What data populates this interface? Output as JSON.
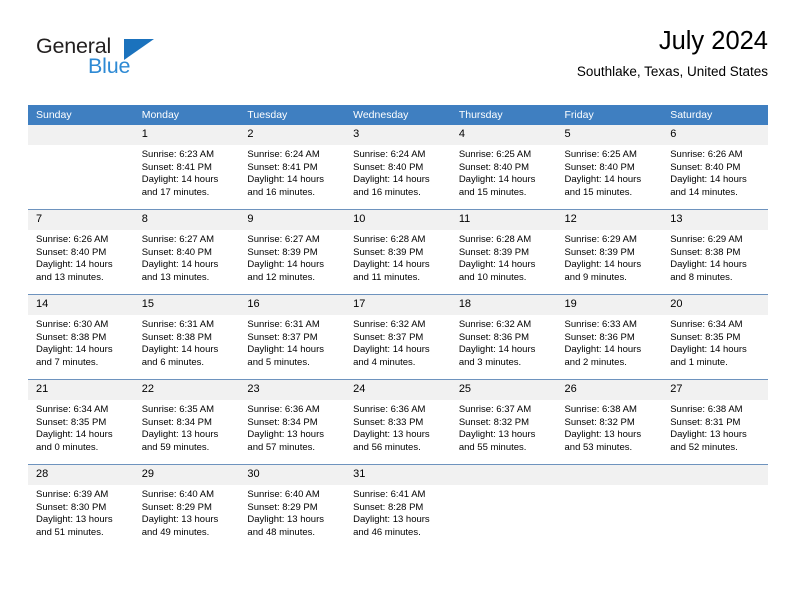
{
  "brand": {
    "name_dark": "General",
    "name_light": "Blue",
    "triangle_color": "#1b72bd",
    "light_color": "#2e8ad4"
  },
  "header": {
    "title": "July 2024",
    "subtitle": "Southlake, Texas, United States"
  },
  "theme": {
    "header_row_bg": "#3f7fc1",
    "day_number_bg": "#f1f1f1",
    "row_divider": "#6e93be"
  },
  "weekdays": [
    "Sunday",
    "Monday",
    "Tuesday",
    "Wednesday",
    "Thursday",
    "Friday",
    "Saturday"
  ],
  "weeks": [
    [
      {
        "day": "",
        "sunrise": "",
        "sunset": "",
        "daylight1": "",
        "daylight2": ""
      },
      {
        "day": "1",
        "sunrise": "Sunrise: 6:23 AM",
        "sunset": "Sunset: 8:41 PM",
        "daylight1": "Daylight: 14 hours",
        "daylight2": "and 17 minutes."
      },
      {
        "day": "2",
        "sunrise": "Sunrise: 6:24 AM",
        "sunset": "Sunset: 8:41 PM",
        "daylight1": "Daylight: 14 hours",
        "daylight2": "and 16 minutes."
      },
      {
        "day": "3",
        "sunrise": "Sunrise: 6:24 AM",
        "sunset": "Sunset: 8:40 PM",
        "daylight1": "Daylight: 14 hours",
        "daylight2": "and 16 minutes."
      },
      {
        "day": "4",
        "sunrise": "Sunrise: 6:25 AM",
        "sunset": "Sunset: 8:40 PM",
        "daylight1": "Daylight: 14 hours",
        "daylight2": "and 15 minutes."
      },
      {
        "day": "5",
        "sunrise": "Sunrise: 6:25 AM",
        "sunset": "Sunset: 8:40 PM",
        "daylight1": "Daylight: 14 hours",
        "daylight2": "and 15 minutes."
      },
      {
        "day": "6",
        "sunrise": "Sunrise: 6:26 AM",
        "sunset": "Sunset: 8:40 PM",
        "daylight1": "Daylight: 14 hours",
        "daylight2": "and 14 minutes."
      }
    ],
    [
      {
        "day": "7",
        "sunrise": "Sunrise: 6:26 AM",
        "sunset": "Sunset: 8:40 PM",
        "daylight1": "Daylight: 14 hours",
        "daylight2": "and 13 minutes."
      },
      {
        "day": "8",
        "sunrise": "Sunrise: 6:27 AM",
        "sunset": "Sunset: 8:40 PM",
        "daylight1": "Daylight: 14 hours",
        "daylight2": "and 13 minutes."
      },
      {
        "day": "9",
        "sunrise": "Sunrise: 6:27 AM",
        "sunset": "Sunset: 8:39 PM",
        "daylight1": "Daylight: 14 hours",
        "daylight2": "and 12 minutes."
      },
      {
        "day": "10",
        "sunrise": "Sunrise: 6:28 AM",
        "sunset": "Sunset: 8:39 PM",
        "daylight1": "Daylight: 14 hours",
        "daylight2": "and 11 minutes."
      },
      {
        "day": "11",
        "sunrise": "Sunrise: 6:28 AM",
        "sunset": "Sunset: 8:39 PM",
        "daylight1": "Daylight: 14 hours",
        "daylight2": "and 10 minutes."
      },
      {
        "day": "12",
        "sunrise": "Sunrise: 6:29 AM",
        "sunset": "Sunset: 8:39 PM",
        "daylight1": "Daylight: 14 hours",
        "daylight2": "and 9 minutes."
      },
      {
        "day": "13",
        "sunrise": "Sunrise: 6:29 AM",
        "sunset": "Sunset: 8:38 PM",
        "daylight1": "Daylight: 14 hours",
        "daylight2": "and 8 minutes."
      }
    ],
    [
      {
        "day": "14",
        "sunrise": "Sunrise: 6:30 AM",
        "sunset": "Sunset: 8:38 PM",
        "daylight1": "Daylight: 14 hours",
        "daylight2": "and 7 minutes."
      },
      {
        "day": "15",
        "sunrise": "Sunrise: 6:31 AM",
        "sunset": "Sunset: 8:38 PM",
        "daylight1": "Daylight: 14 hours",
        "daylight2": "and 6 minutes."
      },
      {
        "day": "16",
        "sunrise": "Sunrise: 6:31 AM",
        "sunset": "Sunset: 8:37 PM",
        "daylight1": "Daylight: 14 hours",
        "daylight2": "and 5 minutes."
      },
      {
        "day": "17",
        "sunrise": "Sunrise: 6:32 AM",
        "sunset": "Sunset: 8:37 PM",
        "daylight1": "Daylight: 14 hours",
        "daylight2": "and 4 minutes."
      },
      {
        "day": "18",
        "sunrise": "Sunrise: 6:32 AM",
        "sunset": "Sunset: 8:36 PM",
        "daylight1": "Daylight: 14 hours",
        "daylight2": "and 3 minutes."
      },
      {
        "day": "19",
        "sunrise": "Sunrise: 6:33 AM",
        "sunset": "Sunset: 8:36 PM",
        "daylight1": "Daylight: 14 hours",
        "daylight2": "and 2 minutes."
      },
      {
        "day": "20",
        "sunrise": "Sunrise: 6:34 AM",
        "sunset": "Sunset: 8:35 PM",
        "daylight1": "Daylight: 14 hours",
        "daylight2": "and 1 minute."
      }
    ],
    [
      {
        "day": "21",
        "sunrise": "Sunrise: 6:34 AM",
        "sunset": "Sunset: 8:35 PM",
        "daylight1": "Daylight: 14 hours",
        "daylight2": "and 0 minutes."
      },
      {
        "day": "22",
        "sunrise": "Sunrise: 6:35 AM",
        "sunset": "Sunset: 8:34 PM",
        "daylight1": "Daylight: 13 hours",
        "daylight2": "and 59 minutes."
      },
      {
        "day": "23",
        "sunrise": "Sunrise: 6:36 AM",
        "sunset": "Sunset: 8:34 PM",
        "daylight1": "Daylight: 13 hours",
        "daylight2": "and 57 minutes."
      },
      {
        "day": "24",
        "sunrise": "Sunrise: 6:36 AM",
        "sunset": "Sunset: 8:33 PM",
        "daylight1": "Daylight: 13 hours",
        "daylight2": "and 56 minutes."
      },
      {
        "day": "25",
        "sunrise": "Sunrise: 6:37 AM",
        "sunset": "Sunset: 8:32 PM",
        "daylight1": "Daylight: 13 hours",
        "daylight2": "and 55 minutes."
      },
      {
        "day": "26",
        "sunrise": "Sunrise: 6:38 AM",
        "sunset": "Sunset: 8:32 PM",
        "daylight1": "Daylight: 13 hours",
        "daylight2": "and 53 minutes."
      },
      {
        "day": "27",
        "sunrise": "Sunrise: 6:38 AM",
        "sunset": "Sunset: 8:31 PM",
        "daylight1": "Daylight: 13 hours",
        "daylight2": "and 52 minutes."
      }
    ],
    [
      {
        "day": "28",
        "sunrise": "Sunrise: 6:39 AM",
        "sunset": "Sunset: 8:30 PM",
        "daylight1": "Daylight: 13 hours",
        "daylight2": "and 51 minutes."
      },
      {
        "day": "29",
        "sunrise": "Sunrise: 6:40 AM",
        "sunset": "Sunset: 8:29 PM",
        "daylight1": "Daylight: 13 hours",
        "daylight2": "and 49 minutes."
      },
      {
        "day": "30",
        "sunrise": "Sunrise: 6:40 AM",
        "sunset": "Sunset: 8:29 PM",
        "daylight1": "Daylight: 13 hours",
        "daylight2": "and 48 minutes."
      },
      {
        "day": "31",
        "sunrise": "Sunrise: 6:41 AM",
        "sunset": "Sunset: 8:28 PM",
        "daylight1": "Daylight: 13 hours",
        "daylight2": "and 46 minutes."
      },
      {
        "day": "",
        "sunrise": "",
        "sunset": "",
        "daylight1": "",
        "daylight2": ""
      },
      {
        "day": "",
        "sunrise": "",
        "sunset": "",
        "daylight1": "",
        "daylight2": ""
      },
      {
        "day": "",
        "sunrise": "",
        "sunset": "",
        "daylight1": "",
        "daylight2": ""
      }
    ]
  ]
}
